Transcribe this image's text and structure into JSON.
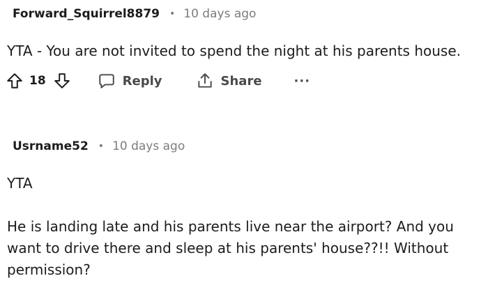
{
  "comments": [
    {
      "author": "Forward_Squirrel8879",
      "separator": "•",
      "time": "10 days ago",
      "lines": [
        "YTA - You are not invited to spend the night at his parents house."
      ],
      "votes": "18",
      "reply_label": "Reply",
      "share_label": "Share",
      "more_label": "···",
      "icons": [
        "upvote-icon",
        "downvote-icon",
        "reply-icon",
        "share-icon",
        "more-icon"
      ]
    },
    {
      "author": "Usrname52",
      "separator": "•",
      "time": "10 days ago",
      "paragraph1": "YTA",
      "lines": [
        "He is landing late and his parents live near the airport? And you",
        "want to drive there and sleep at his parents' house??!! Without",
        "permission?"
      ]
    }
  ]
}
